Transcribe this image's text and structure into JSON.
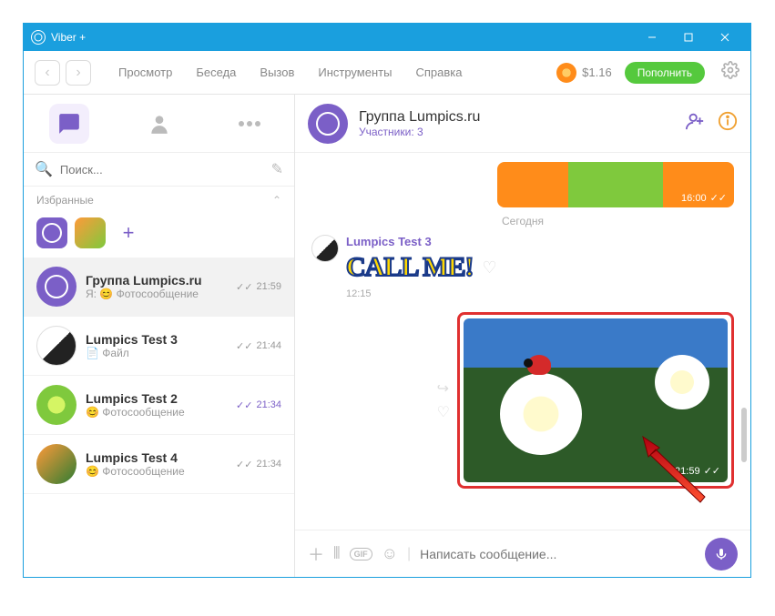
{
  "titlebar": {
    "title": "Viber +"
  },
  "topmenu": {
    "view": "Просмотр",
    "chat": "Беседа",
    "call": "Вызов",
    "tools": "Инструменты",
    "help": "Справка"
  },
  "balance": "$1.16",
  "topup": "Пополнить",
  "search": {
    "placeholder": "Поиск..."
  },
  "favorites": {
    "header": "Избранные"
  },
  "chats": [
    {
      "name": "Группа Lumpics.ru",
      "sub": "Я: 😊 Фотосообщение",
      "time": "21:59",
      "read": true
    },
    {
      "name": "Lumpics Test 3",
      "sub": "📄 Файл",
      "time": "21:44",
      "read": true
    },
    {
      "name": "Lumpics Test 2",
      "sub": "😊 Фотосообщение",
      "time": "21:34",
      "read": true,
      "accent": true
    },
    {
      "name": "Lumpics Test 4",
      "sub": "😊 Фотосообщение",
      "time": "21:34",
      "read": true
    }
  ],
  "header": {
    "name": "Группа Lumpics.ru",
    "members": "Участники: 3"
  },
  "prev_ts": "16:00",
  "day": "Сегодня",
  "incoming": {
    "sender": "Lumpics Test 3",
    "sticker": "CALL ME!",
    "time": "12:15"
  },
  "photo_ts": "21:59",
  "composer": {
    "placeholder": "Написать сообщение..."
  }
}
